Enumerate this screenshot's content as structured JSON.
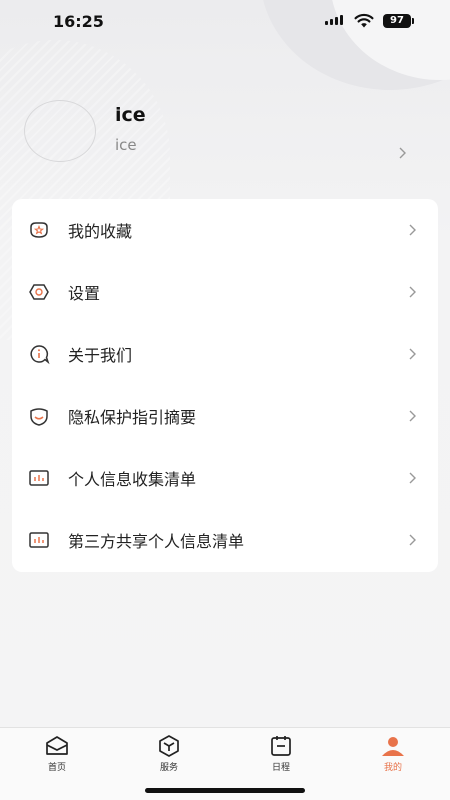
{
  "status_bar": {
    "time": "16:25",
    "battery": "97"
  },
  "profile": {
    "name": "ice",
    "subtitle": "ice"
  },
  "menu": [
    {
      "label": "我的收藏",
      "icon": "favorite-icon"
    },
    {
      "label": "设置",
      "icon": "settings-icon"
    },
    {
      "label": "关于我们",
      "icon": "about-icon"
    },
    {
      "label": "隐私保护指引摘要",
      "icon": "privacy-shield-icon"
    },
    {
      "label": "个人信息收集清单",
      "icon": "list-chart-icon"
    },
    {
      "label": "第三方共享个人信息清单",
      "icon": "list-chart-icon"
    }
  ],
  "tabbar": [
    {
      "label": "首页",
      "icon": "home-icon",
      "active": false
    },
    {
      "label": "服务",
      "icon": "service-box-icon",
      "active": false
    },
    {
      "label": "日程",
      "icon": "schedule-icon",
      "active": false
    },
    {
      "label": "我的",
      "icon": "profile-icon",
      "active": true
    }
  ],
  "colors": {
    "accent": "#e8734a",
    "text": "#222222",
    "muted": "#888888",
    "card": "#ffffff"
  }
}
